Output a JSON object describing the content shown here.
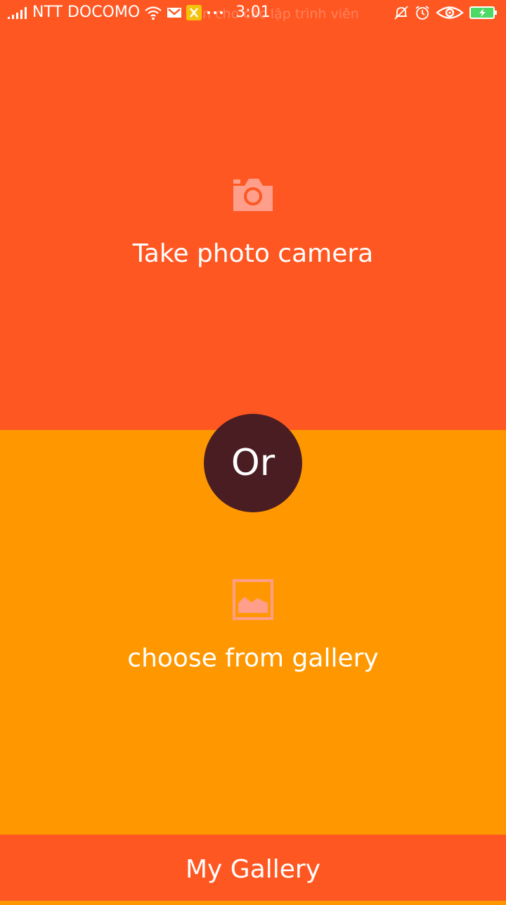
{
  "status_bar": {
    "carrier": "NTT DOCOMO",
    "time": "3:01",
    "ticker_text": "n cho các lập trình viên",
    "icons": [
      "signal-icon",
      "wifi-icon",
      "mail-icon",
      "tools-notification-icon",
      "more-dots-icon",
      "bell-off-icon",
      "alarm-icon",
      "eye-icon",
      "battery-charging-icon"
    ]
  },
  "camera_panel": {
    "icon": "camera-icon",
    "label": "Take photo camera"
  },
  "divider": {
    "label": "Or"
  },
  "gallery_panel": {
    "icon": "image-icon",
    "label": "choose from gallery"
  },
  "bottom_bar": {
    "label": "My Gallery"
  },
  "colors": {
    "primary": "#FF5722",
    "secondary": "#FF9800",
    "circle": "#4A1D22",
    "icon_tint": "#FF9E8A",
    "text": "#FFFFFF"
  }
}
